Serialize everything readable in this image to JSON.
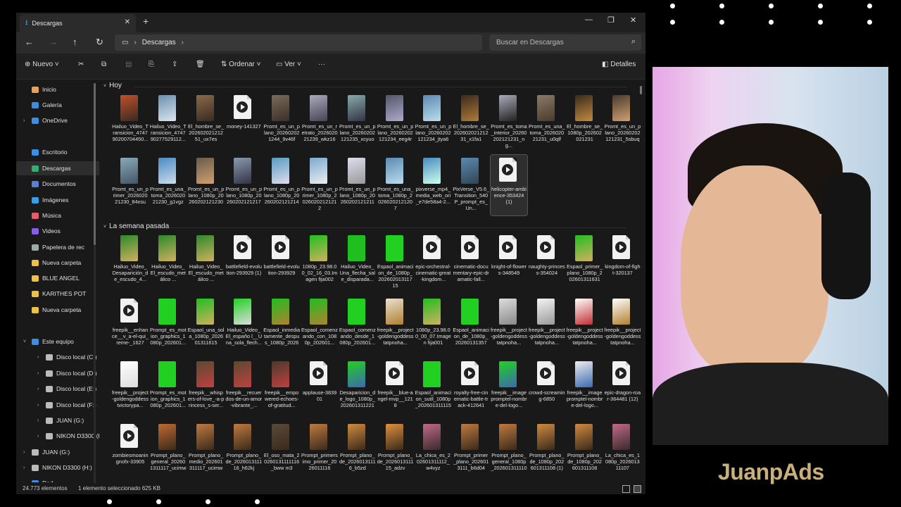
{
  "titlebar": {
    "tab_title": "Descargas",
    "new_tab": "+",
    "minimize": "—",
    "maximize": "❐",
    "close": "✕"
  },
  "navbar": {
    "back": "←",
    "forward": "→",
    "up": "↑",
    "refresh": "↻",
    "breadcrumb": "Descargas",
    "search_placeholder": "Buscar en Descargas"
  },
  "toolbar": {
    "new_label": "Nuevo",
    "sort_label": "Ordenar",
    "view_label": "Ver",
    "more": "···",
    "details_label": "Detalles"
  },
  "sidebar": {
    "items": [
      {
        "label": "Inicio",
        "icon": "home-icon",
        "color": "#e8a44a",
        "pin": false
      },
      {
        "label": "Galería",
        "icon": "gallery-icon",
        "color": "#3a8ee6",
        "pin": false
      },
      {
        "label": "OneDrive",
        "icon": "cloud-icon",
        "color": "#3a8ee6",
        "pin": false,
        "chev": true
      },
      {
        "label": "Escritorio",
        "icon": "desktop-icon",
        "color": "#3a8ee6",
        "pin": true
      },
      {
        "label": "Descargas",
        "icon": "download-icon",
        "color": "#29b36b",
        "pin": true,
        "selected": true
      },
      {
        "label": "Documentos",
        "icon": "documents-icon",
        "color": "#5b7fd6",
        "pin": true
      },
      {
        "label": "Imágenes",
        "icon": "pictures-icon",
        "color": "#3a9ee6",
        "pin": true
      },
      {
        "label": "Música",
        "icon": "music-icon",
        "color": "#e65b6a",
        "pin": true
      },
      {
        "label": "Videos",
        "icon": "videos-icon",
        "color": "#8a5be6",
        "pin": true
      },
      {
        "label": "Papelera de rec",
        "icon": "recycle-bin-icon",
        "color": "#9aa",
        "pin": true
      },
      {
        "label": "Nueva carpeta",
        "icon": "folder-icon",
        "color": "#f0c040",
        "pin": true
      },
      {
        "label": "BLUE ANGEL",
        "icon": "folder-icon",
        "color": "#f0c040",
        "pin": true
      },
      {
        "label": "KARITHES POT",
        "icon": "folder-icon",
        "color": "#f0c040",
        "pin": true
      },
      {
        "label": "Nueva carpeta",
        "icon": "folder-icon",
        "color": "#f0c040",
        "pin": false
      },
      {
        "label": "Este equipo",
        "icon": "pc-icon",
        "color": "#3a8ee6",
        "pin": false,
        "chev": true,
        "open": true
      },
      {
        "label": "Disco local (C:)",
        "icon": "drive-icon",
        "color": "#bbb",
        "pin": false,
        "chev": true,
        "indent": true
      },
      {
        "label": "Disco local (D:)",
        "icon": "drive-icon",
        "color": "#bbb",
        "pin": false,
        "chev": true,
        "indent": true
      },
      {
        "label": "Disco local (E:)",
        "icon": "drive-icon",
        "color": "#bbb",
        "pin": false,
        "chev": true,
        "indent": true
      },
      {
        "label": "Disco local (F:)",
        "icon": "drive-icon",
        "color": "#bbb",
        "pin": false,
        "chev": true,
        "indent": true
      },
      {
        "label": "JUAN (G:)",
        "icon": "drive-icon",
        "color": "#bbb",
        "pin": false,
        "chev": true,
        "indent": true
      },
      {
        "label": "NIKON D3300 (H",
        "icon": "camera-icon",
        "color": "#bbb",
        "pin": false,
        "chev": true,
        "indent": true
      },
      {
        "label": "JUAN (G:)",
        "icon": "drive-icon",
        "color": "#bbb",
        "pin": false,
        "chev": true
      },
      {
        "label": "NIKON D3300 (H:)",
        "icon": "camera-icon",
        "color": "#bbb",
        "pin": false,
        "chev": true
      },
      {
        "label": "Red",
        "icon": "network-icon",
        "color": "#3a8ee6",
        "pin": false,
        "chev": true
      }
    ]
  },
  "groups": {
    "today": "Hoy",
    "last_week": "La semana pasada"
  },
  "files_today": [
    {
      "name": "Hailuo_Video_Transicion_474790200704450...",
      "kind": "img",
      "c1": "#c0502a",
      "c2": "#3a2a22"
    },
    {
      "name": "Hailuo_Video_Transicion_474790277529112...",
      "kind": "img",
      "c1": "#6a90b0",
      "c2": "#dbe6ef"
    },
    {
      "name": "El_hombre_se_20260202121251_ux7es",
      "kind": "img",
      "c1": "#8a6a4a",
      "c2": "#3a2a20"
    },
    {
      "name": "money-141327",
      "kind": "doc"
    },
    {
      "name": "Promt_es_un_plano_202602021244_9v46f",
      "kind": "img",
      "c1": "#7a6a5a",
      "c2": "#3a3028"
    },
    {
      "name": "Promt_es_un_retrato_202602021239_wkz16",
      "kind": "img",
      "c1": "#aab",
      "c2": "#445"
    },
    {
      "name": "Promt_es_un_plano_20260202121235_xcyuo",
      "kind": "img",
      "c1": "#8aa",
      "c2": "#334"
    },
    {
      "name": "Promt_es_un_plano_20260202121234_eeg4r",
      "kind": "img",
      "c1": "#556",
      "c2": "#aac"
    },
    {
      "name": "Promt_es_un_plano_20260202121234_jtya6",
      "kind": "img",
      "c1": "#5a8ab0",
      "c2": "#bde"
    },
    {
      "name": "El_hombre_se_20260202121231_x1fa1",
      "kind": "img",
      "c1": "#3a2a1a",
      "c2": "#b07a3a"
    },
    {
      "name": "Promt_es_toma_interior_20260202121231_ng...",
      "kind": "img",
      "c1": "#aab",
      "c2": "#222"
    },
    {
      "name": "Promt_es_una_toma_202602021231_u0qlf",
      "kind": "img",
      "c1": "#8a7a6a",
      "c2": "#4a3a2a"
    },
    {
      "name": "El_hombre_se_1080p_202602021231",
      "kind": "img",
      "c1": "#3a2a1a",
      "c2": "#c08a40"
    },
    {
      "name": "Promt_es_un_plano_20260202121231_5sbuq",
      "kind": "img",
      "c1": "#4a3a30",
      "c2": "#d0a070"
    },
    {
      "name": "Promt_es_un_primer_202602021230_84xsu",
      "kind": "img",
      "c1": "#8ab",
      "c2": "#456"
    },
    {
      "name": "Promt_es_una_toma_202602021230_g1vgz",
      "kind": "img",
      "c1": "#4a8ac0",
      "c2": "#cde"
    },
    {
      "name": "Promt_es_un_plano_1080p_20260202121230",
      "kind": "img",
      "c1": "#6a5a4a",
      "c2": "#d0a070"
    },
    {
      "name": "Promt_es_un_plano_1080p_20260202121217",
      "kind": "img",
      "c1": "#8a9ab0",
      "c2": "#334"
    },
    {
      "name": "Promt_es_un_plano_1080p_20260202121214",
      "kind": "img",
      "c1": "#5a9ac0",
      "c2": "#dde"
    },
    {
      "name": "Promt_es_un_primer_1080p_20260202121212",
      "kind": "img",
      "c1": "#7aaad0",
      "c2": "#eee"
    },
    {
      "name": "Promt_es_un_plano_1080p_20260202121211",
      "kind": "img",
      "c1": "#dde",
      "c2": "#999"
    },
    {
      "name": "Promt_es_una_toma_1080p_20260202121207",
      "kind": "img",
      "c1": "#5a8ab0",
      "c2": "#bde"
    },
    {
      "name": "pixverse_mp4_media_web_ori_e7de58a4-2...",
      "kind": "img",
      "c1": "#4a8ac0",
      "c2": "#cfe"
    },
    {
      "name": "PixVerse_V5.6_Transition_540P_prompt_es_Un...",
      "kind": "img",
      "c1": "#5a8ab0",
      "c2": "#345"
    },
    {
      "name": "helicopter-ambience-353424 (1)",
      "kind": "doc",
      "selected": true
    }
  ],
  "files_week": [
    {
      "name": "Hailuo_Video_Desaparición_de_escudo_4...",
      "kind": "img",
      "c1": "#2a8a2a",
      "c2": "#d0b060"
    },
    {
      "name": "Hailuo_Video_El_escudo_metálico ...",
      "kind": "img",
      "c1": "#2a8a2a",
      "c2": "#d0b060"
    },
    {
      "name": "Hailuo_Video_El_escudo_metálico ...",
      "kind": "img",
      "c1": "#2a8a2a",
      "c2": "#d0b060"
    },
    {
      "name": "battlefield-evolution-293929 (1)",
      "kind": "doc"
    },
    {
      "name": "battlefield-evolution-293929",
      "kind": "doc"
    },
    {
      "name": "1080p_23.98.00_02_16_03.Imagen fija002",
      "kind": "img",
      "c1": "#1fbf1f",
      "c2": "#d0b060"
    },
    {
      "name": "Hailuo_Video_Una_flecha_sale_disparada...",
      "kind": "img",
      "c1": "#1fbf1f",
      "c2": "#1fbf1f"
    },
    {
      "name": "Espaol_animacion_de_1080p_20260201311715",
      "kind": "img",
      "c1": "#22d022",
      "c2": "#22d022"
    },
    {
      "name": "epic-orchestral-cinematic-great-kingdom...",
      "kind": "doc"
    },
    {
      "name": "cinematic-documentary-epic-dramatic-fall...",
      "kind": "doc"
    },
    {
      "name": "knight-of-flowers-348549",
      "kind": "doc"
    },
    {
      "name": "naughty-princess-354024",
      "kind": "doc"
    },
    {
      "name": "Espaol_primer_plano_1080p_202601311631",
      "kind": "img",
      "c1": "#1fbf1f",
      "c2": "#d0b060"
    },
    {
      "name": "kingdom-of-fight-320137",
      "kind": "doc"
    },
    {
      "name": "freepik__enhance__v_a-el-qui_reme-_1627",
      "kind": "doc"
    },
    {
      "name": "Prompt_es_motion_graphics_1080p_202601...",
      "kind": "img",
      "c1": "#22d022",
      "c2": "#22d022"
    },
    {
      "name": "Espaol_una_sola_1080p_202601311615",
      "kind": "img",
      "c1": "#1fbf1f",
      "c2": "#d0b060"
    },
    {
      "name": "Hailuo_Video_El_españo l__Una_sola_flech...",
      "kind": "img",
      "c1": "#22d022",
      "c2": "#ddd"
    },
    {
      "name": "Espaol_inmediatamente_despus_1080p_2026",
      "kind": "img",
      "c1": "#1fbf1f",
      "c2": "#b08030"
    },
    {
      "name": "Espaol_comenzando_con_1080p_202601...",
      "kind": "img",
      "c1": "#1fbf1f",
      "c2": "#b08030"
    },
    {
      "name": "Espaol_comenzando_desde_1080p_202601...",
      "kind": "img",
      "c1": "#22d022",
      "c2": "#22d022"
    },
    {
      "name": "freepik__project-goldengoddesstatpnoha...",
      "kind": "img",
      "c1": "#e8e0d0",
      "c2": "#b08030"
    },
    {
      "name": "1080p_23.98.00_00_07.Imagen fija001",
      "kind": "img",
      "c1": "#1fbf1f",
      "c2": "#d0b060"
    },
    {
      "name": "Espaol_animacion_de_1080p_20260131357",
      "kind": "img",
      "c1": "#22d022",
      "c2": "#22d022"
    },
    {
      "name": "freepik__project-goldengoddesstatpnoha...",
      "kind": "img",
      "c1": "#ddd",
      "c2": "#888"
    },
    {
      "name": "freepik__project-goldengoddesstatpnoha...",
      "kind": "img",
      "c1": "#f4f4f4",
      "c2": "#999"
    },
    {
      "name": "freepik__project-goldengoddesstatpnoha...",
      "kind": "img",
      "c1": "#fff",
      "c2": "#c03030"
    },
    {
      "name": "freepik__project-goldengoddesstatpnoha...",
      "kind": "img",
      "c1": "#fff",
      "c2": "#b08030"
    },
    {
      "name": "freepik__project-goldengoddesstvictorypa...",
      "kind": "img",
      "c1": "#fff",
      "c2": "#ddd"
    },
    {
      "name": "Prompt_es_motion_graphics_1080p_202601...",
      "kind": "img",
      "c1": "#22d022",
      "c2": "#22d022"
    },
    {
      "name": "freepik__whispers-of-love_-a-princess_s-ser...",
      "kind": "img",
      "c1": "#5a4a30",
      "c2": "#c04040"
    },
    {
      "name": "freepik__recuerdos-de-un-amor-vibrante_...",
      "kind": "img",
      "c1": "#5a4a30",
      "c2": "#c04040"
    },
    {
      "name": "freepik__empowered-echoes-of-gratitud...",
      "kind": "img",
      "c1": "#4a3a2a",
      "c2": "#c04040"
    },
    {
      "name": "applause-383901",
      "kind": "doc"
    },
    {
      "name": "Desaparicion_de_logo_1080p_202601311221",
      "kind": "img",
      "c1": "#22d022",
      "c2": "#3a6ab0"
    },
    {
      "name": "freepik__blue-angel-mvp__1218",
      "kind": "doc"
    },
    {
      "name": "Espaol_animacion_sutil_1080p_202601311115",
      "kind": "img",
      "c1": "#22d022",
      "c2": "#22d022"
    },
    {
      "name": "royalty-free-cinematic-battle-track-412641",
      "kind": "doc"
    },
    {
      "name": "freepik__imagepromptel-nombre-del-logo...",
      "kind": "img",
      "c1": "#22d022",
      "c2": "#3a6ab0"
    },
    {
      "name": "crowd-screaming-6850",
      "kind": "doc"
    },
    {
      "name": "freepik__imagepromptel-nombre-del-logo...",
      "kind": "img",
      "c1": "#eee",
      "c2": "#3a6ab0"
    },
    {
      "name": "epic-dragon-roar-364481 (12)",
      "kind": "doc"
    },
    {
      "name": "zombiesmoaningnofx-33905",
      "kind": "doc"
    },
    {
      "name": "Prompt_plano_general_202601311117_ucimw",
      "kind": "img",
      "c1": "#c06a30",
      "c2": "#3a2a1a"
    },
    {
      "name": "Prompt_plano_medio_202601311117_ucimw",
      "kind": "img",
      "c1": "#c07a40",
      "c2": "#3a2a1a"
    },
    {
      "name": "Prompt_plano_de_202601311116_h62kj",
      "kind": "img",
      "c1": "#c07a40",
      "c2": "#3a2a1a"
    },
    {
      "name": "El_oso_mata_20260131111116_bww m3",
      "kind": "img",
      "c1": "#5a4a3a",
      "c2": "#3a2a1a"
    },
    {
      "name": "Prompt_primersimo_primer_2026011116",
      "kind": "img",
      "c1": "#c07a40",
      "c2": "#3a2a1a"
    },
    {
      "name": "Prompt_plano_de_20260131116_b5zd",
      "kind": "img",
      "c1": "#d08a40",
      "c2": "#3a2a1a"
    },
    {
      "name": "Prompt_plano_de_202601311115_adzv",
      "kind": "img",
      "c1": "#e09040",
      "c2": "#3a2a1a"
    },
    {
      "name": "La_chica_es_202601311112_w4vyz",
      "kind": "img",
      "c1": "#c06a8a",
      "c2": "#3a2a2a"
    },
    {
      "name": "Prompt_primer_plano_2026013111_b6d04",
      "kind": "img",
      "c1": "#c07a40",
      "c2": "#3a2a1a"
    },
    {
      "name": "Prompt_plano_general_1080p_202601311110",
      "kind": "img",
      "c1": "#c07a40",
      "c2": "#3a2a1a"
    },
    {
      "name": "Prompt_plano_de_1080p_202601311108 (1)",
      "kind": "img",
      "c1": "#d08a40",
      "c2": "#3a2a1a"
    },
    {
      "name": "Prompt_plano_de_1080p_202601311108",
      "kind": "img",
      "c1": "#d08a40",
      "c2": "#3a2a1a"
    },
    {
      "name": "La_chica_es_1080p_202601311107",
      "kind": "img",
      "c1": "#c06a8a",
      "c2": "#3a2a2a"
    }
  ],
  "status": {
    "count": "24.773 elementos",
    "selection": "1 elemento seleccionado  625 KB"
  },
  "brand": "JuanpAds"
}
